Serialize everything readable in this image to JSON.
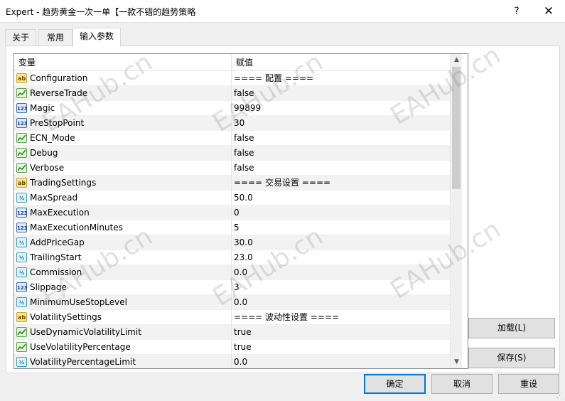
{
  "window": {
    "title": "Expert - 趋势黄金一次一单【一款不错的趋势策略",
    "help_glyph": "?",
    "close_glyph": "✕"
  },
  "tabs": [
    {
      "label": "关于"
    },
    {
      "label": "常用"
    },
    {
      "label": "输入参数"
    }
  ],
  "table": {
    "header_var": "变量",
    "header_val": "赋值",
    "rows": [
      {
        "icon": "ab",
        "name": "Configuration",
        "value": "==== 配置 ===="
      },
      {
        "icon": "bool",
        "name": "ReverseTrade",
        "value": "false"
      },
      {
        "icon": "123",
        "name": "Magic",
        "value": "99899"
      },
      {
        "icon": "123",
        "name": "PreStopPoint",
        "value": "30"
      },
      {
        "icon": "bool",
        "name": "ECN_Mode",
        "value": "false"
      },
      {
        "icon": "bool",
        "name": "Debug",
        "value": "false"
      },
      {
        "icon": "bool",
        "name": "Verbose",
        "value": "false"
      },
      {
        "icon": "ab",
        "name": "TradingSettings",
        "value": "==== 交易设置 ===="
      },
      {
        "icon": "1/2",
        "name": "MaxSpread",
        "value": "50.0"
      },
      {
        "icon": "123",
        "name": "MaxExecution",
        "value": "0"
      },
      {
        "icon": "123",
        "name": "MaxExecutionMinutes",
        "value": "5"
      },
      {
        "icon": "1/2",
        "name": "AddPriceGap",
        "value": "30.0"
      },
      {
        "icon": "1/2",
        "name": "TrailingStart",
        "value": "23.0"
      },
      {
        "icon": "1/2",
        "name": "Commission",
        "value": "0.0"
      },
      {
        "icon": "123",
        "name": "Slippage",
        "value": "3"
      },
      {
        "icon": "1/2",
        "name": "MinimumUseStopLevel",
        "value": "0.0"
      },
      {
        "icon": "ab",
        "name": "VolatilitySettings",
        "value": "==== 波动性设置 ===="
      },
      {
        "icon": "bool",
        "name": "UseDynamicVolatilityLimit",
        "value": "true"
      },
      {
        "icon": "bool",
        "name": "UseVolatilityPercentage",
        "value": "true"
      },
      {
        "icon": "1/2",
        "name": "VolatilityPercentageLimit",
        "value": "0.0"
      }
    ]
  },
  "icon_labels": {
    "ab": "ab",
    "123": "123",
    "1/2": "½"
  },
  "buttons": {
    "load": "加载(L)",
    "save": "保存(S)",
    "ok": "确定",
    "cancel": "取消",
    "reset": "重设"
  },
  "watermark": "EAHub.cn",
  "colors": {
    "accent": "#0078d7",
    "row_alt": "#f2f2f2"
  }
}
